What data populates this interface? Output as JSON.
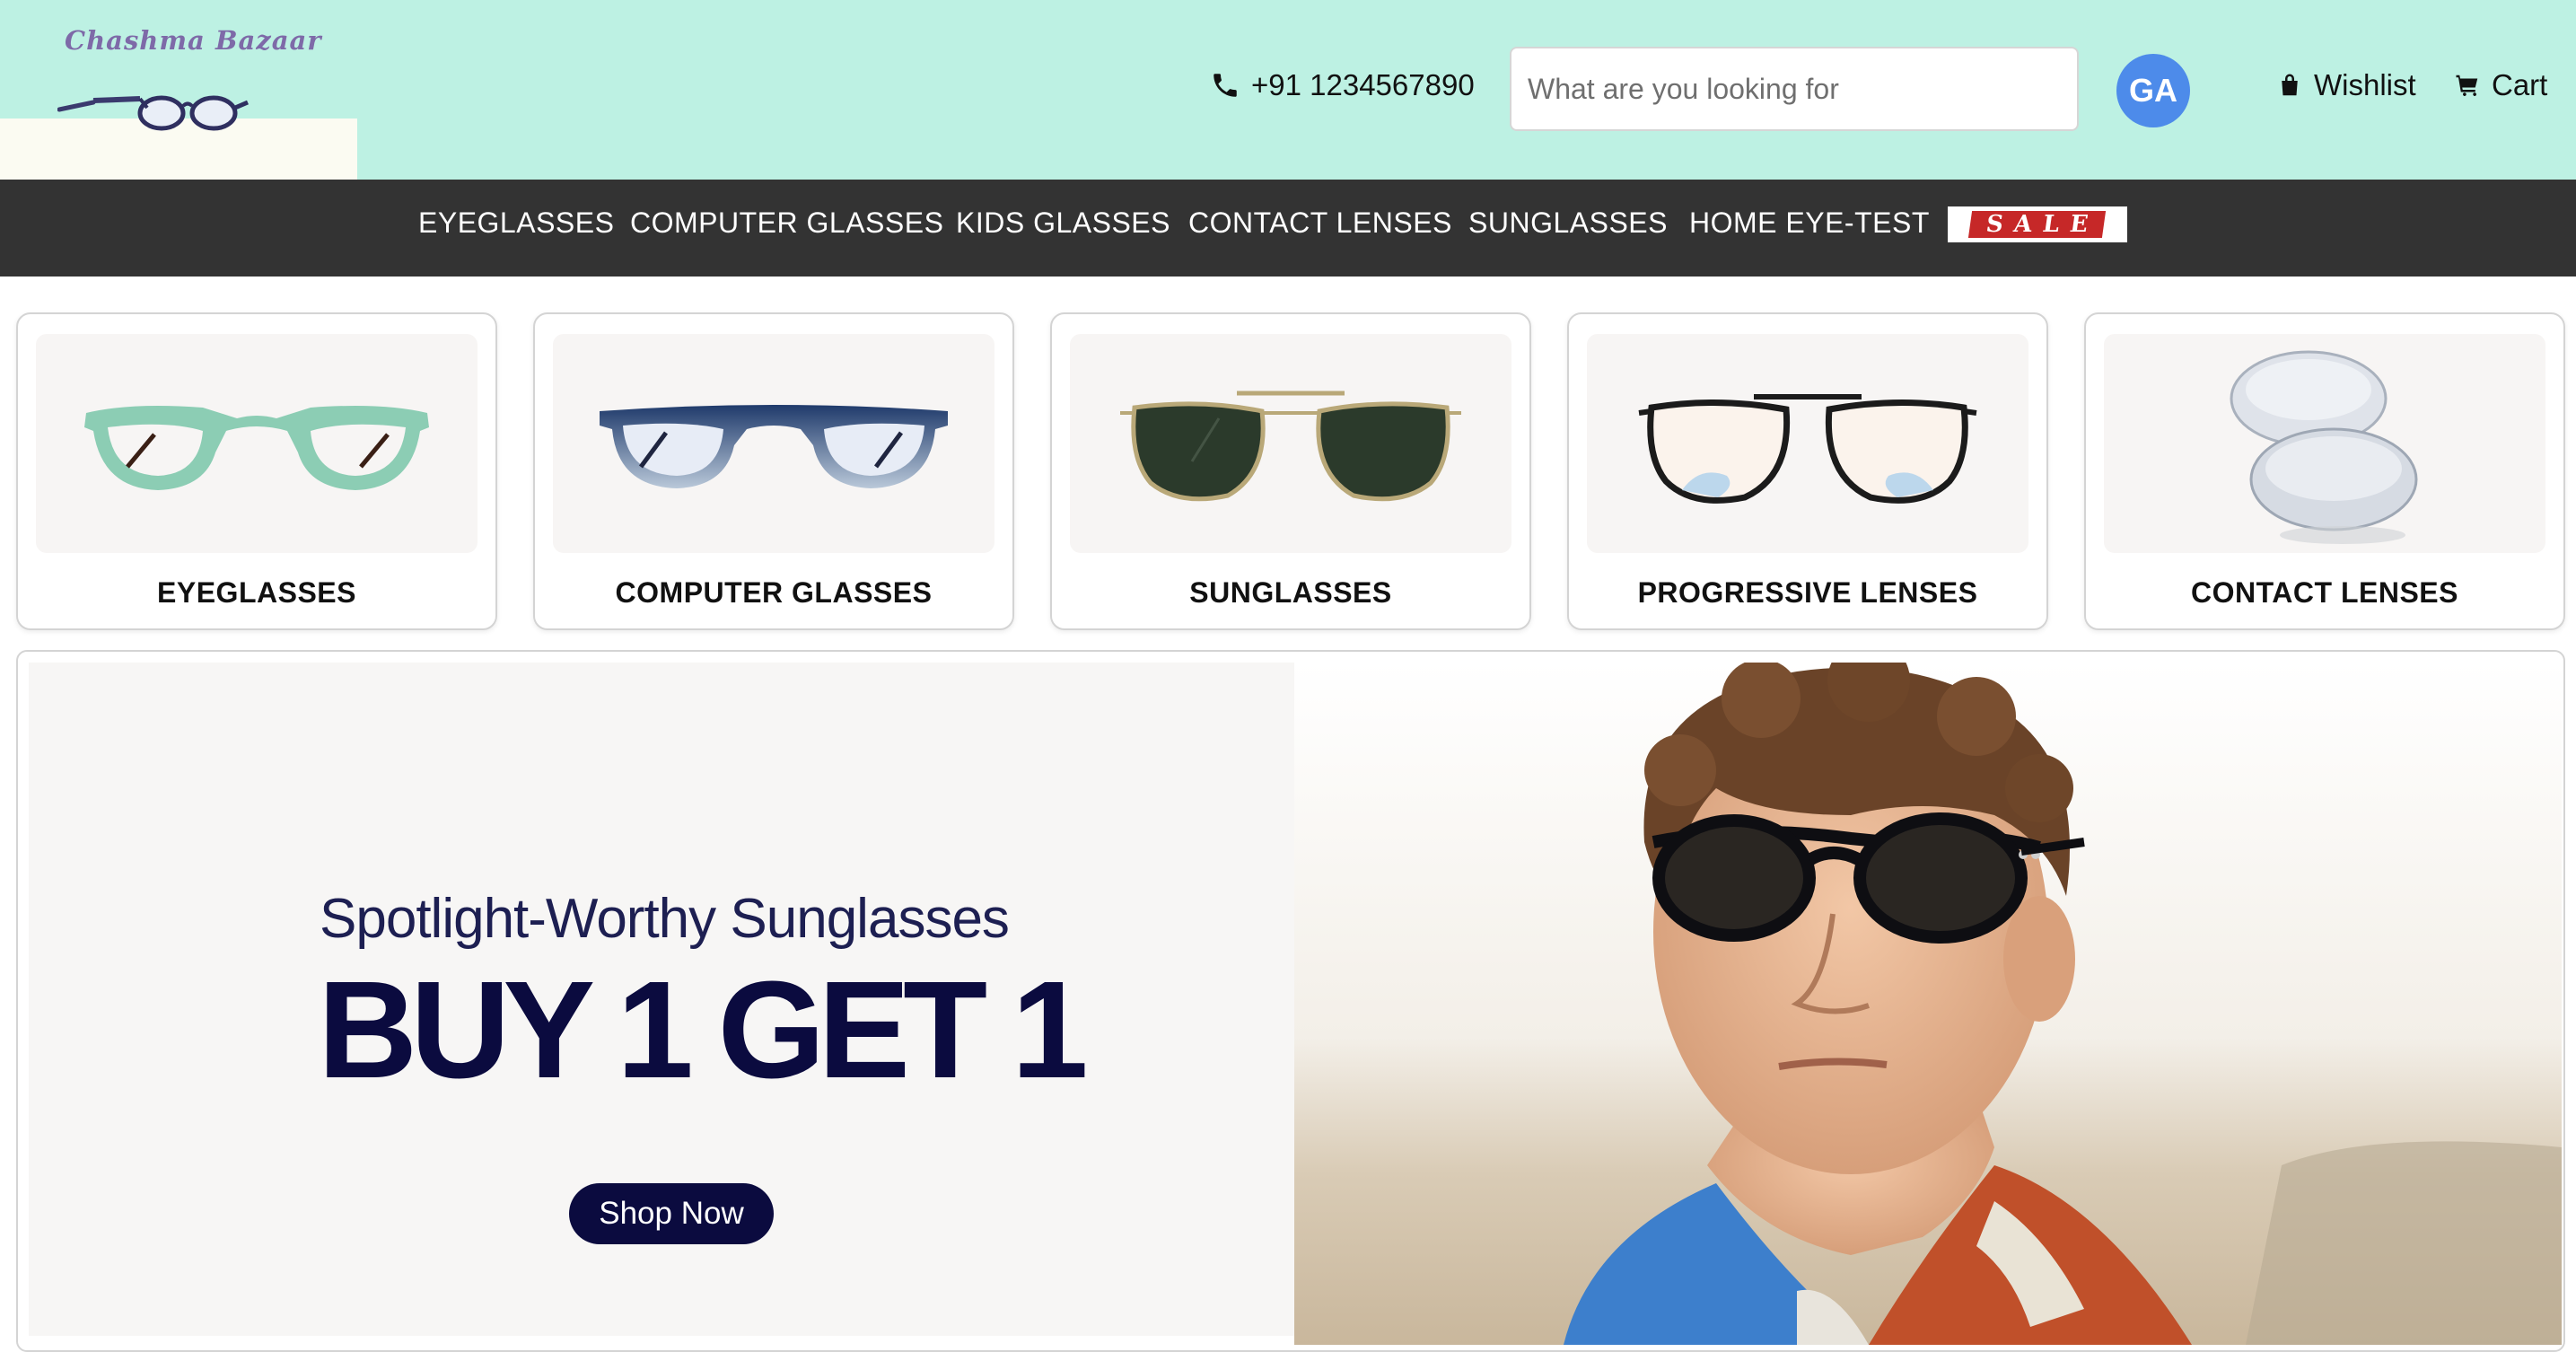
{
  "brand": {
    "name": "Chashma Bazaar"
  },
  "header": {
    "phone": "+91 1234567890",
    "search_placeholder": "What are you looking for",
    "avatar_initials": "GA",
    "wishlist_label": "Wishlist",
    "cart_label": "Cart"
  },
  "nav": {
    "items": [
      "EYEGLASSES",
      "COMPUTER GLASSES",
      "KIDS GLASSES",
      "CONTACT LENSES",
      "SUNGLASSES",
      "HOME EYE-TEST"
    ],
    "sale_label": "SALE"
  },
  "categories": [
    {
      "label": "EYEGLASSES",
      "icon": "green-eyeglasses-icon"
    },
    {
      "label": "COMPUTER GLASSES",
      "icon": "blue-computer-glasses-icon"
    },
    {
      "label": "SUNGLASSES",
      "icon": "aviator-sunglasses-icon"
    },
    {
      "label": "PROGRESSIVE LENSES",
      "icon": "progressive-glasses-icon"
    },
    {
      "label": "CONTACT LENSES",
      "icon": "contact-lens-icon"
    }
  ],
  "banner": {
    "subtitle": "Spotlight-Worthy Sunglasses",
    "title": "BUY 1 GET 1",
    "cta_label": "Shop Now"
  },
  "colors": {
    "header_bg": "#bdf1e3",
    "nav_bg": "#333333",
    "avatar_bg": "#4d8bea",
    "banner_navy": "#0b0b3f",
    "sale_red": "#c62828"
  }
}
